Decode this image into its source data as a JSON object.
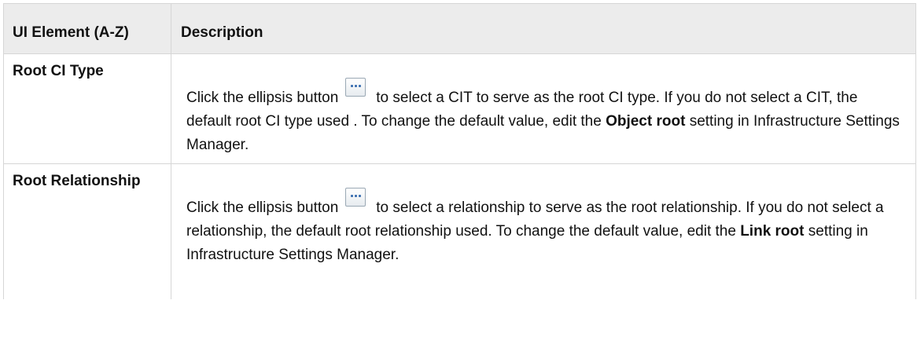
{
  "table": {
    "headers": {
      "element": "UI Element (A-Z)",
      "description": "Description"
    },
    "rows": [
      {
        "element": "Root CI Type",
        "desc_before_icon": "Click the ellipsis button",
        "desc_after_icon": "to select a CIT to serve as the root CI type. If you do not select a CIT, the default root CI type used . To change the default value, edit the",
        "setting_name": "Object root",
        "desc_tail": "setting in Infrastructure Settings Manager."
      },
      {
        "element": "Root Relationship",
        "desc_before_icon": "Click the ellipsis button",
        "desc_after_icon": "to select a relationship to serve as the root relationship. If you do not select a relationship, the default root relationship used. To change the default value, edit the",
        "setting_name": "Link root",
        "desc_tail": "setting in Infrastructure Settings Manager."
      }
    ]
  },
  "icons": {
    "ellipsis": "ellipsis-button-icon"
  },
  "colors": {
    "header_background": "#ececec",
    "border": "#d6d6d6",
    "icon_dots": "#3b6fb0"
  }
}
